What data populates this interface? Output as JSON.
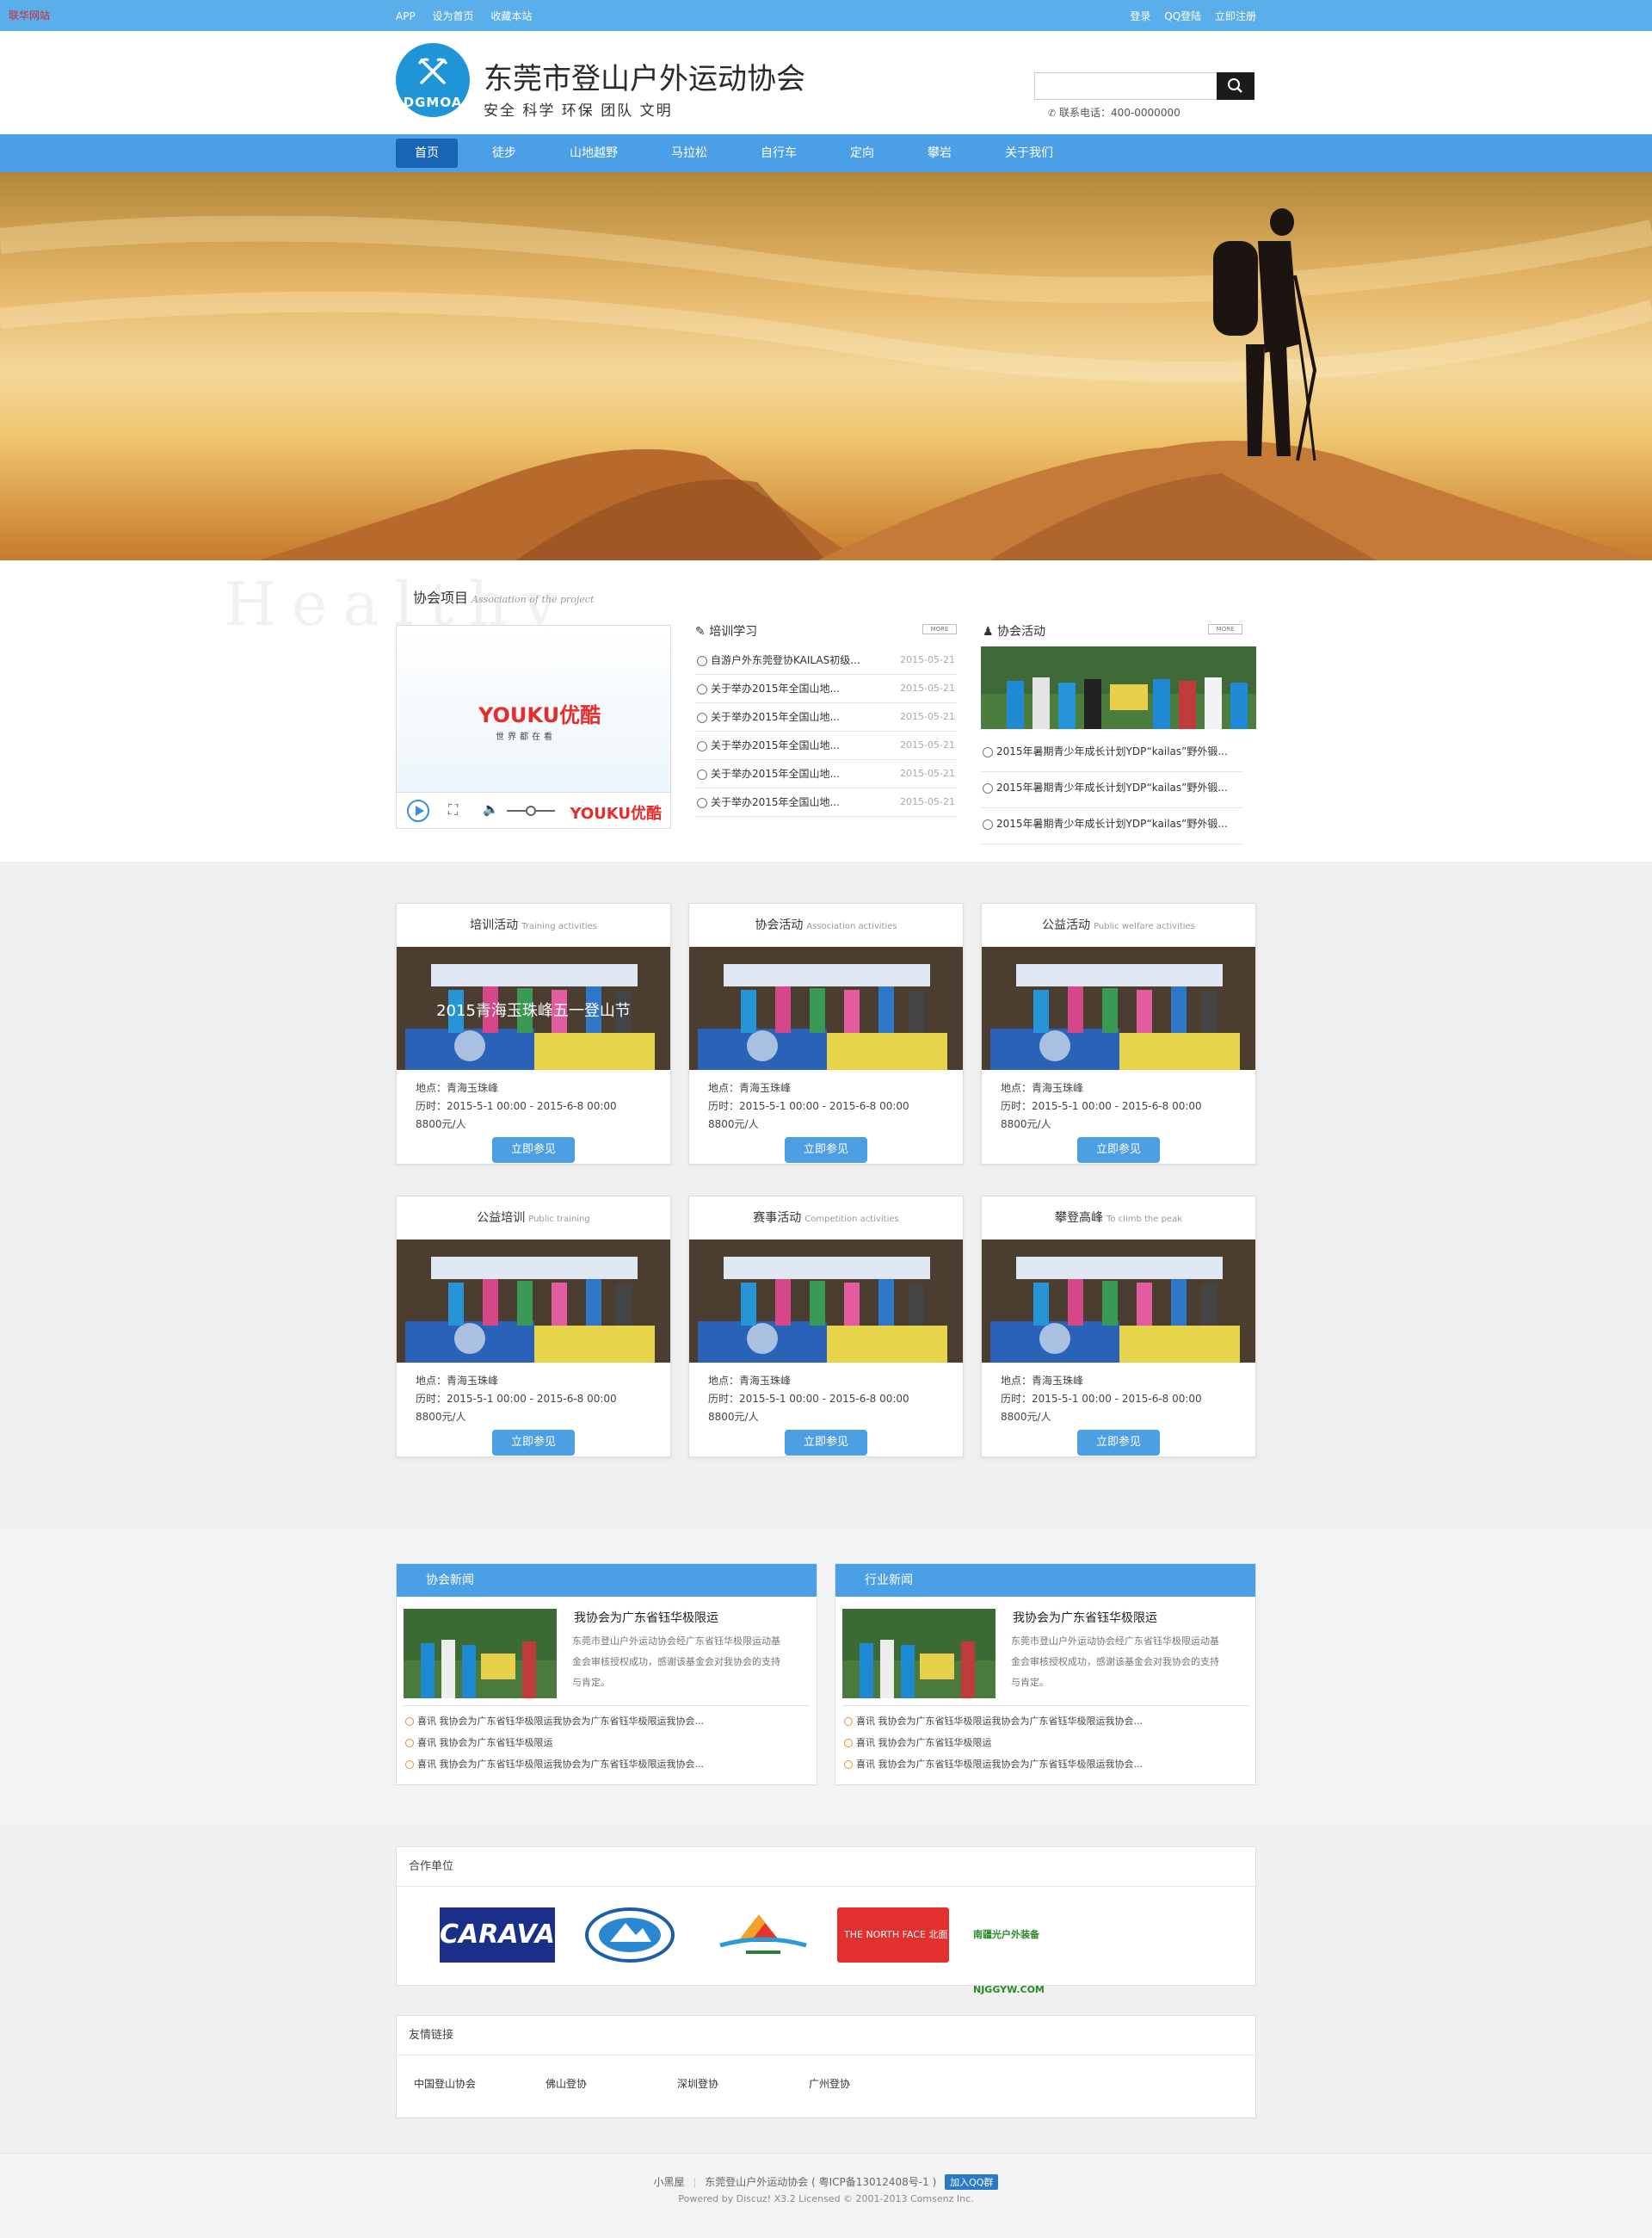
{
  "topbar": {
    "corner": "联华网站",
    "left": [
      "APP",
      "设为首页",
      "收藏本站"
    ],
    "right": [
      "登录",
      "QQ登陆",
      "立即注册"
    ]
  },
  "header": {
    "logo_abbr": "DGMOA",
    "title": "东莞市登山户外运动协会",
    "slogan": "安全 科学 环保 团队 文明",
    "search_placeholder": "",
    "phone": "联系电话：400-0000000"
  },
  "nav": [
    "首页",
    "徒步",
    "山地越野",
    "马拉松",
    "自行车",
    "定向",
    "攀岩",
    "关于我们"
  ],
  "project": {
    "bg_word": "Healthy",
    "title": "协会项目",
    "title_en": "Association of the project",
    "video_brand": "YOUKU优酷",
    "video_sub": "世界都在看",
    "training_head": "培训学习",
    "activity_head": "协会活动",
    "more": "MORE",
    "training": [
      {
        "text": "自游户外东莞登协KAILAS初级...",
        "date": "2015-05-21"
      },
      {
        "text": "关于举办2015年全国山地...",
        "date": "2015-05-21"
      },
      {
        "text": "关于举办2015年全国山地...",
        "date": "2015-05-21"
      },
      {
        "text": "关于举办2015年全国山地...",
        "date": "2015-05-21"
      },
      {
        "text": "关于举办2015年全国山地...",
        "date": "2015-05-21"
      },
      {
        "text": "关于举办2015年全国山地...",
        "date": "2015-05-21"
      }
    ],
    "activities": [
      "2015年暑期青少年成长计划YDP“kailas”野外锻...",
      "2015年暑期青少年成长计划YDP“kailas”野外锻...",
      "2015年暑期青少年成长计划YDP“kailas”野外锻..."
    ]
  },
  "cards": [
    {
      "title": "培训活动",
      "en": "Training activities",
      "overlay": "2015青海玉珠峰五一登山节",
      "place": "地点：青海玉珠峰",
      "time": "历时：2015-5-1 00:00 - 2015-6-8 00:00",
      "price": "8800元/人",
      "button": "立即参见"
    },
    {
      "title": "协会活动",
      "en": "Association activities",
      "overlay": "",
      "place": "地点：青海玉珠峰",
      "time": "历时：2015-5-1 00:00 - 2015-6-8 00:00",
      "price": "8800元/人",
      "button": "立即参见"
    },
    {
      "title": "公益活动",
      "en": "Public welfare activities",
      "overlay": "",
      "place": "地点：青海玉珠峰",
      "time": "历时：2015-5-1 00:00 - 2015-6-8 00:00",
      "price": "8800元/人",
      "button": "立即参见"
    },
    {
      "title": "公益培训",
      "en": "Public training",
      "overlay": "",
      "place": "地点：青海玉珠峰",
      "time": "历时：2015-5-1 00:00 - 2015-6-8 00:00",
      "price": "8800元/人",
      "button": "立即参见"
    },
    {
      "title": "赛事活动",
      "en": "Competition activities",
      "overlay": "",
      "place": "地点：青海玉珠峰",
      "time": "历时：2015-5-1 00:00 - 2015-6-8 00:00",
      "price": "8800元/人",
      "button": "立即参见"
    },
    {
      "title": "攀登高峰",
      "en": "To climb the peak",
      "overlay": "",
      "place": "地点：青海玉珠峰",
      "time": "历时：2015-5-1 00:00 - 2015-6-8 00:00",
      "price": "8800元/人",
      "button": "立即参见"
    }
  ],
  "news": [
    {
      "head": "协会新闻",
      "title": "我协会为广东省钰华极限运",
      "desc": "东莞市登山户外运动协会经广东省钰华极限运动基金会审核授权成功，感谢该基金会对我协会的支持与肯定。",
      "items": [
        "喜讯 我协会为广东省钰华极限运我协会为广东省钰华极限运我协会...",
        "喜讯 我协会为广东省钰华极限运",
        "喜讯 我协会为广东省钰华极限运我协会为广东省钰华极限运我协会..."
      ]
    },
    {
      "head": "行业新闻",
      "title": "我协会为广东省钰华极限运",
      "desc": "东莞市登山户外运动协会经广东省钰华极限运动基金会审核授权成功，感谢该基金会对我协会的支持与肯定。",
      "items": [
        "喜讯 我协会为广东省钰华极限运我协会为广东省钰华极限运我协会...",
        "喜讯 我协会为广东省钰华极限运",
        "喜讯 我协会为广东省钰华极限运我协会为广东省钰华极限运我协会..."
      ]
    }
  ],
  "partners": {
    "title": "合作单位",
    "logos": [
      "CARAVA",
      "",
      "",
      "THE NORTH FACE 北面",
      "南疆光户外装备 NJGGYW.COM"
    ]
  },
  "links": {
    "title": "友情链接",
    "items": [
      "中国登山协会",
      "佛山登协",
      "深圳登协",
      "广州登协"
    ]
  },
  "footer": {
    "site": "小黑屋",
    "line1": "东莞登山户外运动协会 ( 粤ICP备13012408号-1 )",
    "qq": "加入QQ群",
    "line2": "Powered by Discuz! X3.2 Licensed © 2001-2013 Comsenz Inc."
  },
  "colors": {
    "topbar": "#5aaeea",
    "nav": "#4b9fe6",
    "nav_active": "#1a65b3",
    "button": "#4d9fe4"
  }
}
